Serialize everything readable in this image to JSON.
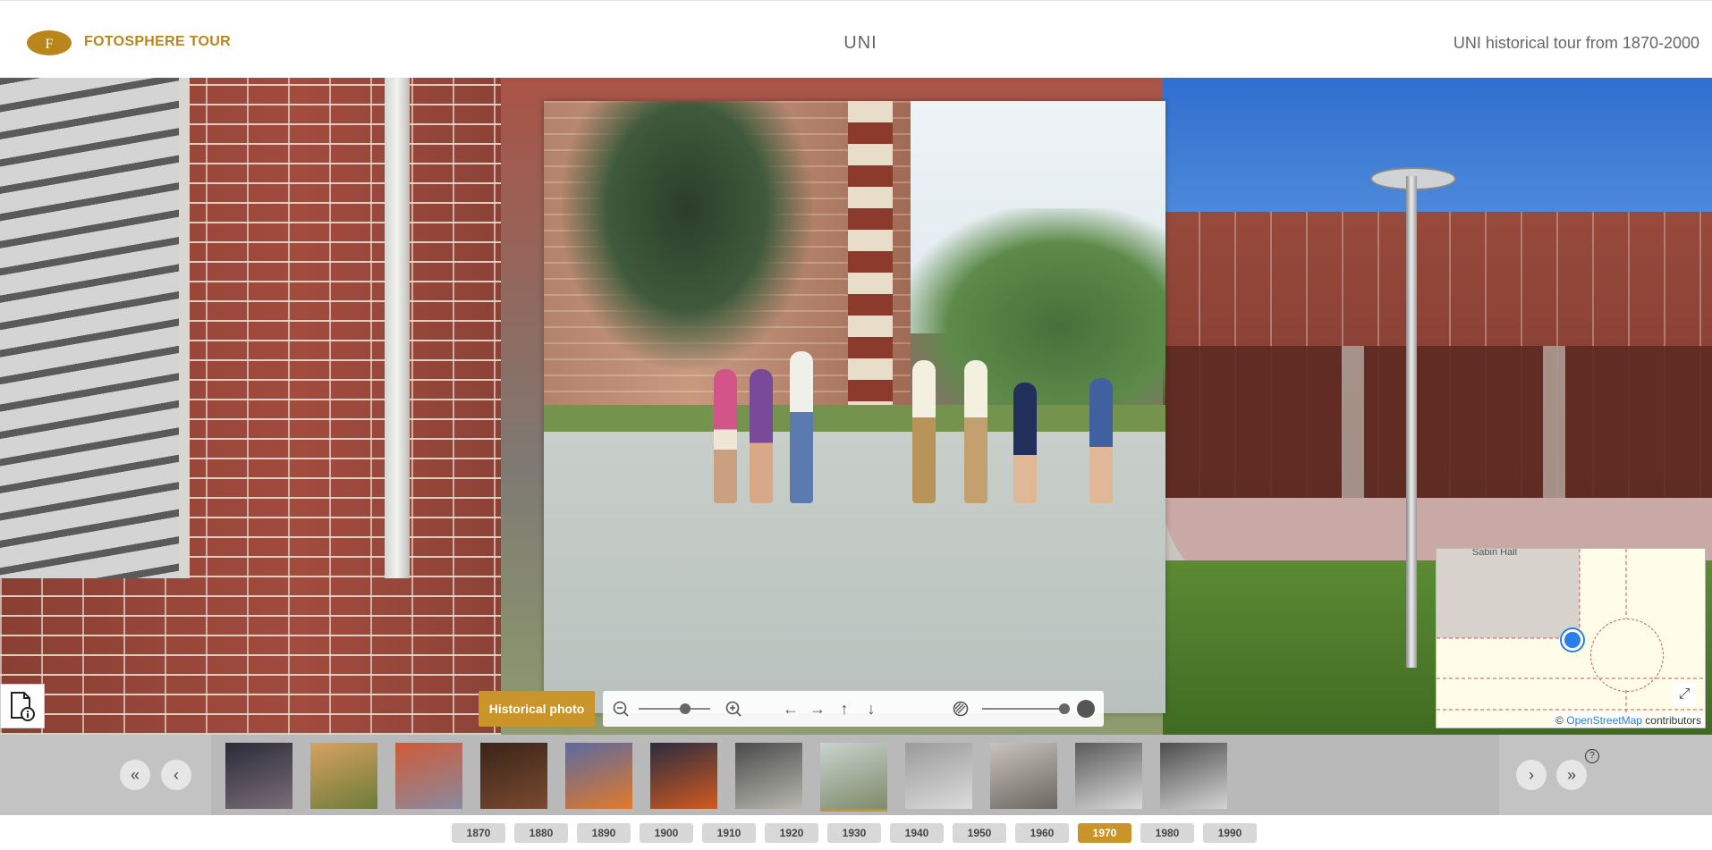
{
  "header": {
    "brand": "FOTOSPHERE TOUR",
    "logo_letter": "F",
    "title": "UNI",
    "subtitle": "UNI historical tour from 1870-2000"
  },
  "overlay": {
    "label": "Historical photo"
  },
  "controls": {
    "zoom_level": 0.65,
    "opacity_level": 1.0,
    "icons": [
      "zoom-out-icon",
      "zoom-in-icon",
      "arrow-left-icon",
      "arrow-right-icon",
      "arrow-up-icon",
      "arrow-down-icon",
      "opacity-icon"
    ]
  },
  "minimap": {
    "place_label": "Sabin Hall",
    "attribution_prefix": "©",
    "attribution_link": "OpenStreetMap",
    "attribution_suffix": "contributors"
  },
  "thumbbar": {
    "help": "?",
    "thumbnails": [
      {
        "colors": [
          "#2b2b3a",
          "#7a6e78"
        ]
      },
      {
        "colors": [
          "#d8a160",
          "#6c7c3a"
        ]
      },
      {
        "colors": [
          "#cf5a36",
          "#8a8aa0"
        ]
      },
      {
        "colors": [
          "#3a2418",
          "#7a4a30"
        ]
      },
      {
        "colors": [
          "#5a6aa0",
          "#e27a2a"
        ]
      },
      {
        "colors": [
          "#2a2c40",
          "#d25a1e"
        ]
      },
      {
        "colors": [
          "#4a4a4a",
          "#b8b8b0"
        ]
      },
      {
        "colors": [
          "#c9d3cf",
          "#7e8a6a"
        ],
        "active": true
      },
      {
        "colors": [
          "#9a9a9a",
          "#dcdcdc"
        ]
      },
      {
        "colors": [
          "#c8c4bc",
          "#6a6660"
        ]
      },
      {
        "colors": [
          "#5a5a5a",
          "#dadada"
        ]
      },
      {
        "colors": [
          "#4c4c4c",
          "#d4d4d4"
        ]
      }
    ]
  },
  "decades": [
    {
      "label": "1870"
    },
    {
      "label": "1880"
    },
    {
      "label": "1890"
    },
    {
      "label": "1900"
    },
    {
      "label": "1910"
    },
    {
      "label": "1920"
    },
    {
      "label": "1930"
    },
    {
      "label": "1940"
    },
    {
      "label": "1950"
    },
    {
      "label": "1960"
    },
    {
      "label": "1970",
      "active": true
    },
    {
      "label": "1980"
    },
    {
      "label": "1990"
    }
  ],
  "colors": {
    "accent": "#c9952a",
    "brand": "#b8861c"
  }
}
